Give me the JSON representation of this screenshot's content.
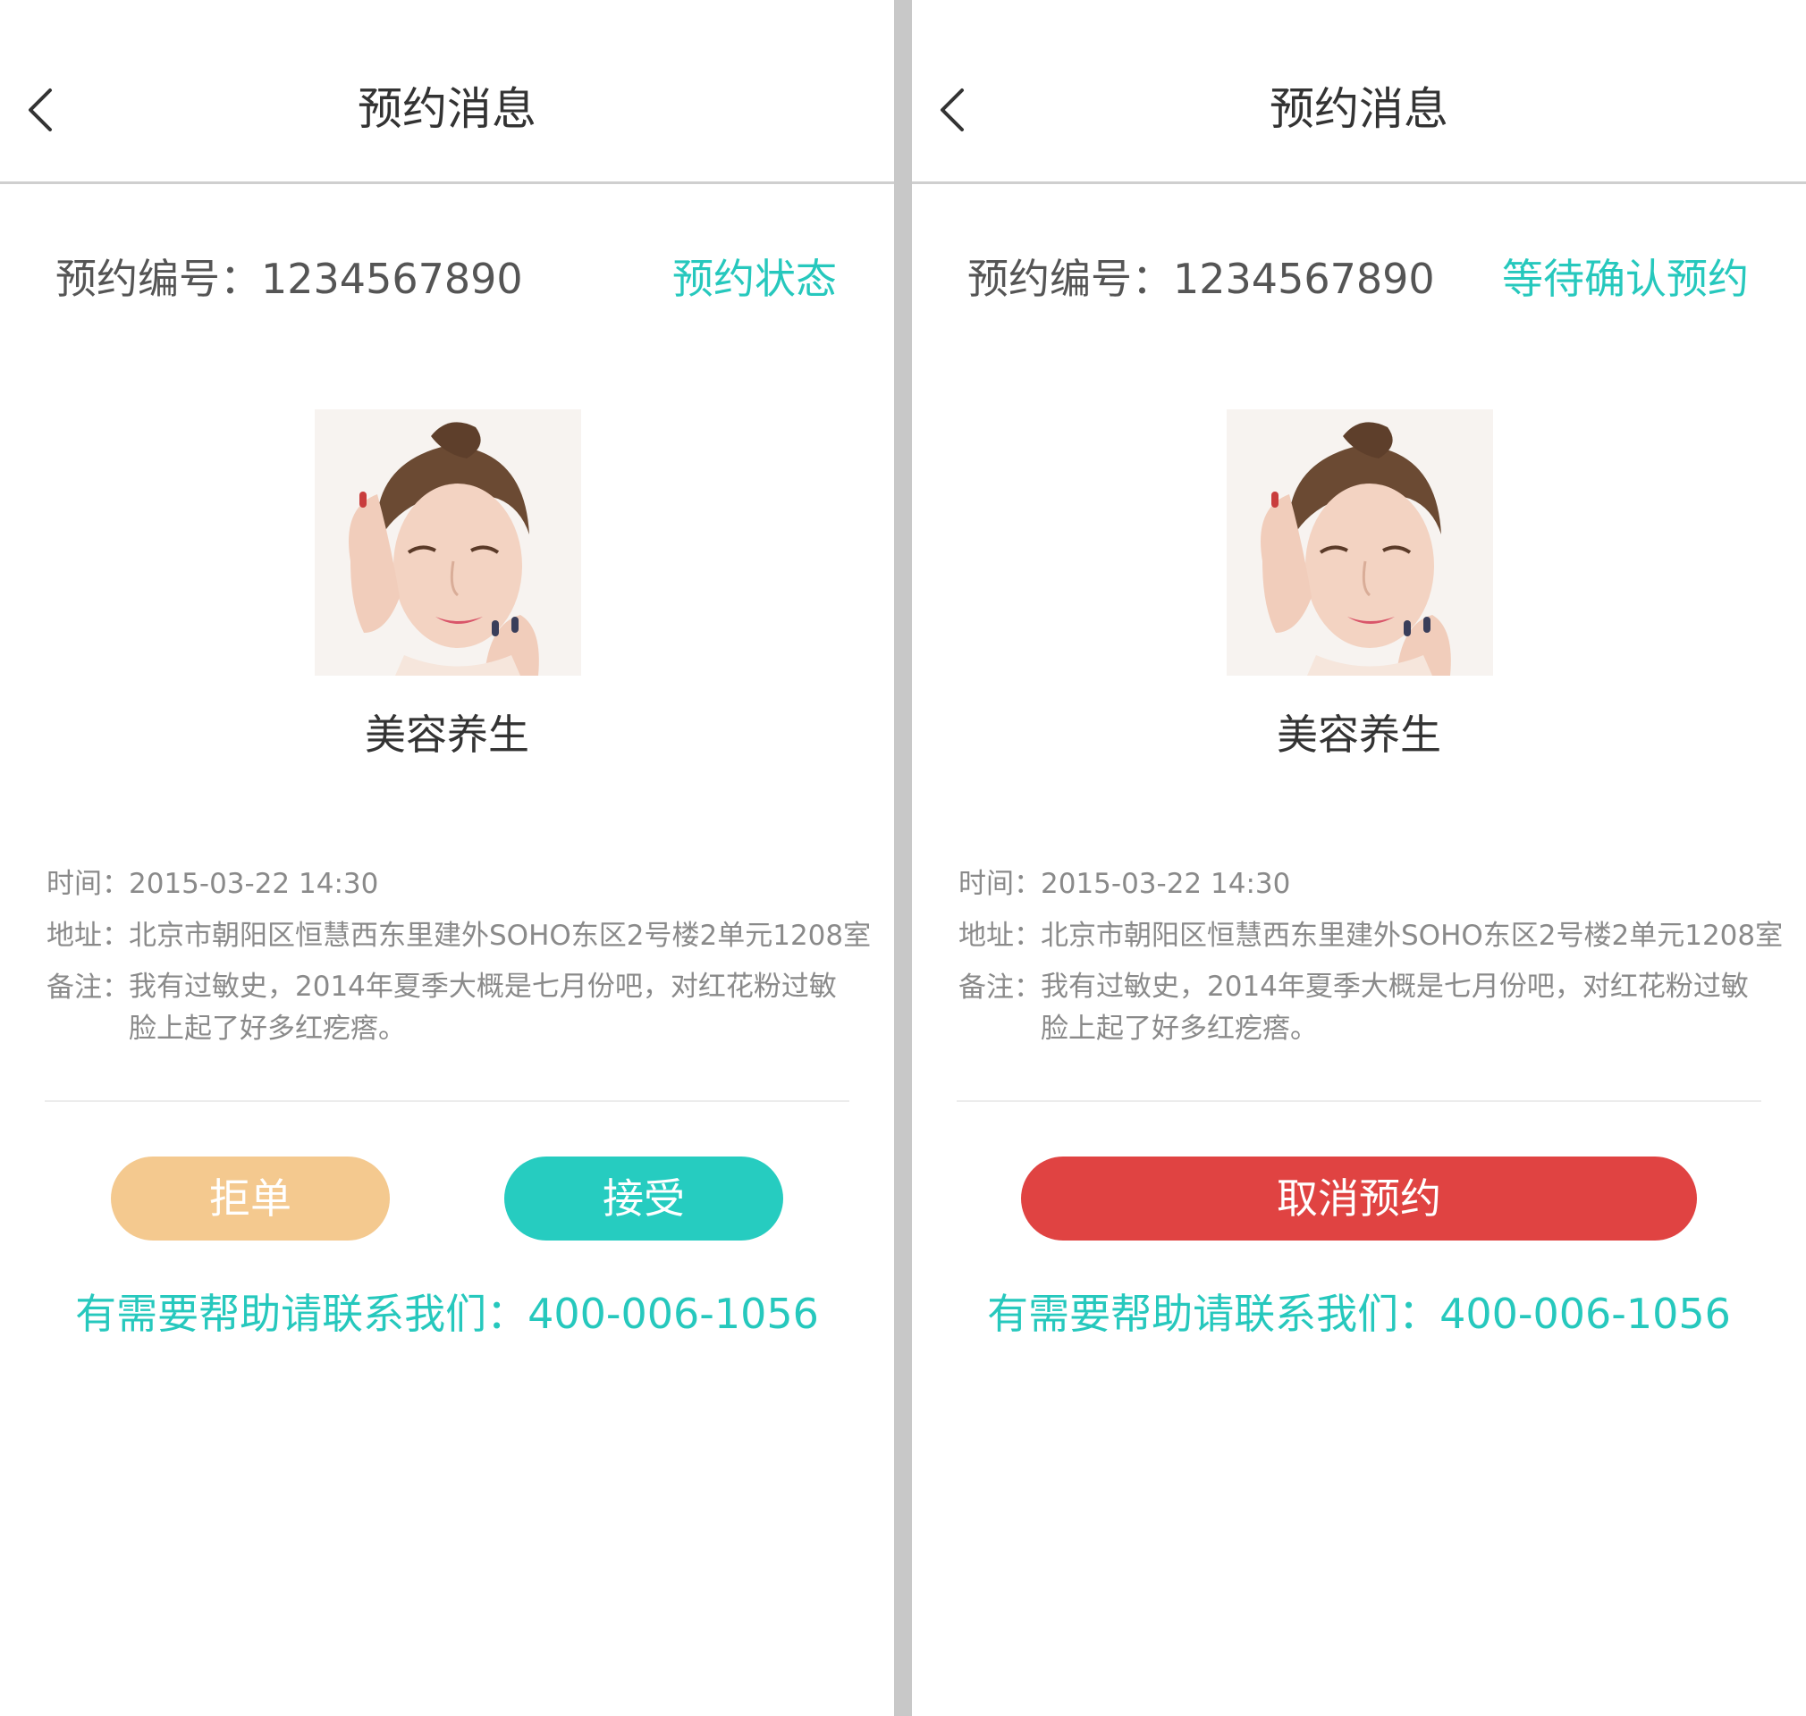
{
  "colors": {
    "accent": "#26c8bd",
    "reject_button": "#f4c98f",
    "accept_button": "#26ccc0",
    "cancel_button": "#e04342",
    "divider": "#c8c8c8"
  },
  "screens": [
    {
      "header": {
        "title": "预约消息",
        "back_icon": "chevron-left-icon"
      },
      "order": {
        "number": "预约编号：1234567890",
        "status": "预约状态"
      },
      "service": {
        "name": "美容养生",
        "image": "woman-portrait"
      },
      "details": {
        "time_label": "时间：",
        "time_value": "2015-03-22  14:30",
        "address_label": "地址：",
        "address_value": "北京市朝阳区恒慧西东里建外SOHO东区2号楼2单元1208室",
        "note_label": "备注：",
        "note_value": "我有过敏史，2014年夏季大概是七月份吧，对红花粉过敏脸上起了好多红疙瘩。"
      },
      "buttons": {
        "reject": "拒单",
        "accept": "接受"
      },
      "help": "有需要帮助请联系我们：400-006-1056"
    },
    {
      "header": {
        "title": "预约消息",
        "back_icon": "chevron-left-icon"
      },
      "order": {
        "number": "预约编号：1234567890",
        "status": "等待确认预约"
      },
      "service": {
        "name": "美容养生",
        "image": "woman-portrait"
      },
      "details": {
        "time_label": "时间：",
        "time_value": "2015-03-22  14:30",
        "address_label": "地址：",
        "address_value": "北京市朝阳区恒慧西东里建外SOHO东区2号楼2单元1208室",
        "note_label": "备注：",
        "note_value": "我有过敏史，2014年夏季大概是七月份吧，对红花粉过敏脸上起了好多红疙瘩。"
      },
      "buttons": {
        "cancel": "取消预约"
      },
      "help": "有需要帮助请联系我们：400-006-1056"
    }
  ]
}
